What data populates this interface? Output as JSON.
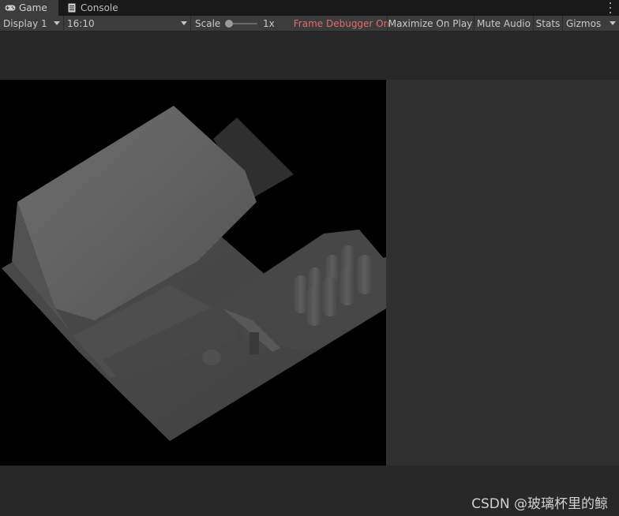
{
  "tabs": [
    {
      "label": "Game",
      "icon": "gamepad-icon",
      "active": true
    },
    {
      "label": "Console",
      "icon": "console-icon",
      "active": false
    }
  ],
  "toolbar": {
    "display": "Display 1",
    "aspect": "16:10",
    "scale_label": "Scale",
    "scale_value": "1x",
    "frame_debugger": "Frame Debugger On",
    "maximize": "Maximize On Play",
    "mute": "Mute Audio",
    "stats": "Stats",
    "gizmos": "Gizmos"
  },
  "colors": {
    "frame_debugger_text": "#e06a6a",
    "toolbar_bg": "#3c3c3c",
    "viewport_bg": "#000000"
  },
  "watermark": "CSDN @玻璃杯里的鲸"
}
